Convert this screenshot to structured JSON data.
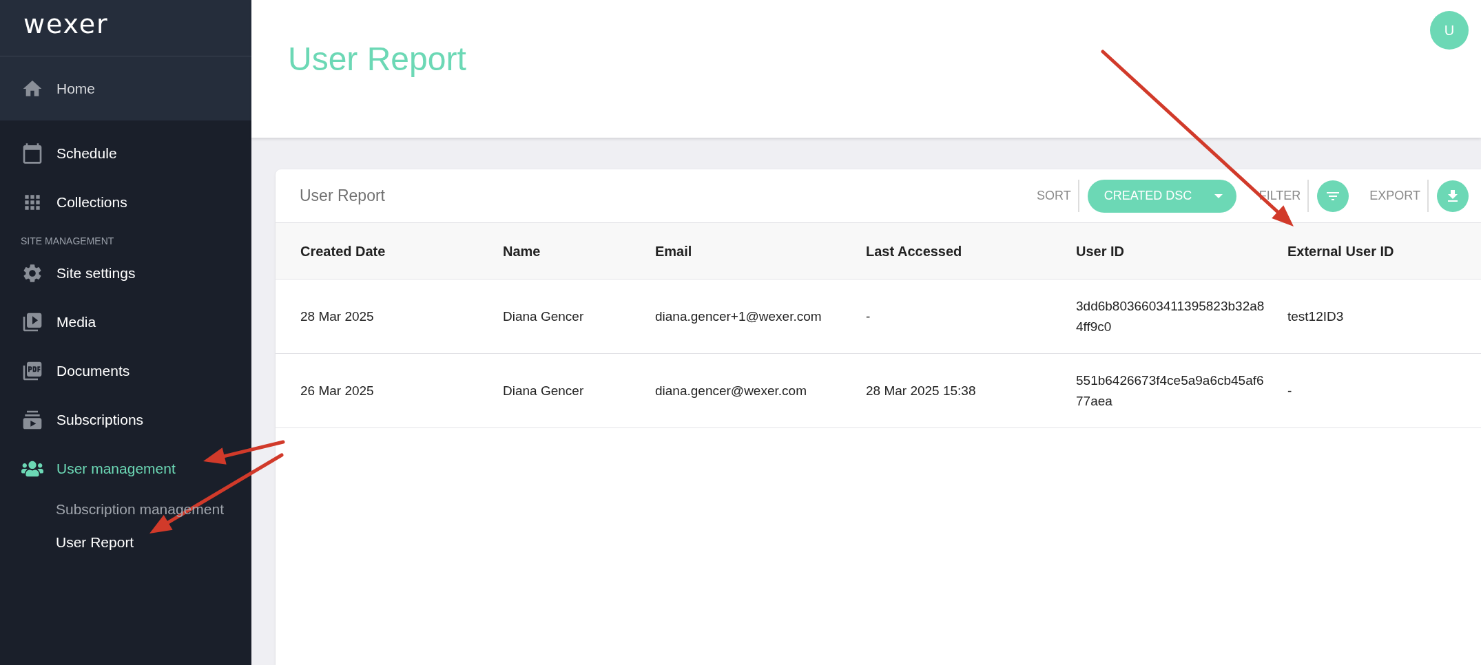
{
  "sidebar": {
    "logo": "wexer",
    "items": [
      {
        "kind": "item",
        "label": "Home",
        "highlighted": true,
        "active": false
      },
      {
        "kind": "item",
        "label": "Schedule",
        "highlighted": false,
        "active": false
      },
      {
        "kind": "item",
        "label": "Collections",
        "highlighted": false,
        "active": false
      },
      {
        "kind": "section",
        "label": "SITE MANAGEMENT"
      },
      {
        "kind": "item",
        "label": "Site settings",
        "highlighted": false,
        "active": false
      },
      {
        "kind": "item",
        "label": "Media",
        "highlighted": false,
        "active": false
      },
      {
        "kind": "item",
        "label": "Documents",
        "highlighted": false,
        "active": false
      },
      {
        "kind": "item",
        "label": "Subscriptions",
        "highlighted": false,
        "active": false
      },
      {
        "kind": "item",
        "label": "User management",
        "highlighted": false,
        "active": true
      },
      {
        "kind": "subitem",
        "label": "Subscription management",
        "selected": false
      },
      {
        "kind": "subitem",
        "label": "User Report",
        "selected": true
      }
    ]
  },
  "header": {
    "title": "User Report",
    "avatar": "U"
  },
  "card": {
    "title": "User Report",
    "sort_label": "SORT",
    "sort_value": "CREATED DSC",
    "filter_label": "FILTER",
    "export_label": "EXPORT"
  },
  "table": {
    "columns": [
      "Created Date",
      "Name",
      "Email",
      "Last Accessed",
      "User ID",
      "External User ID"
    ],
    "rows": [
      [
        "28 Mar 2025",
        "Diana Gencer",
        "diana.gencer+1@wexer.com",
        "-",
        "3dd6b8036603411395823b32a84ff9c0",
        "test12ID3"
      ],
      [
        "26 Mar 2025",
        "Diana Gencer",
        "diana.gencer@wexer.com",
        "28 Mar 2025 15:38",
        "551b6426673f4ce5a9a6cb45af677aea",
        "-"
      ]
    ]
  }
}
